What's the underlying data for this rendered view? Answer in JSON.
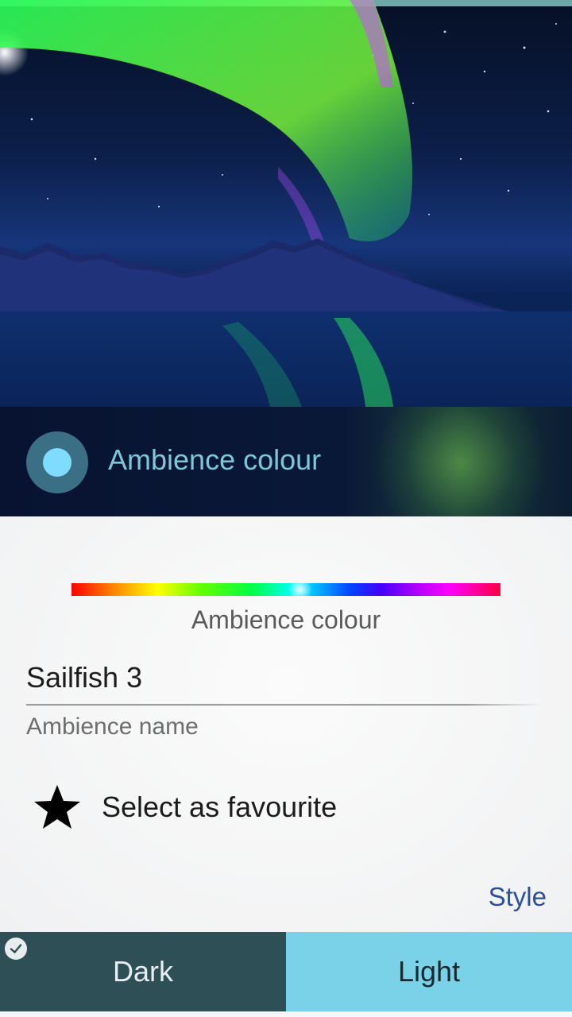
{
  "ambience_bar": {
    "label": "Ambience colour",
    "selected_color": "#7fdcff"
  },
  "colour_picker": {
    "caption": "Ambience colour"
  },
  "ambience_name": {
    "value": "Sailfish 3",
    "label": "Ambience name"
  },
  "favourite": {
    "label": "Select as favourite",
    "icon": "star-icon"
  },
  "style": {
    "label": "Style",
    "options": [
      {
        "label": "Dark",
        "selected": true
      },
      {
        "label": "Light",
        "selected": false
      }
    ]
  },
  "colors": {
    "accent": "#7cc7d9",
    "dark_toggle": "#2f4f56",
    "light_toggle": "#7ad2e8",
    "style_text": "#2c4f9a"
  }
}
